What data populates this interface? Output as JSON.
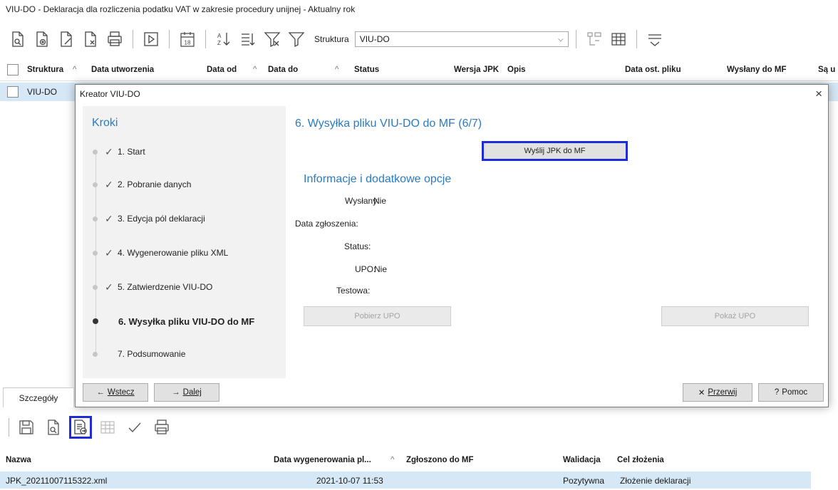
{
  "window": {
    "title": "VIU-DO - Deklaracja dla rozliczenia podatku VAT w zakresie procedury unijnej - Aktualny rok"
  },
  "toolbar": {
    "structure_label": "Struktura",
    "structure_value": "VIU-DO",
    "calendar_day": "18"
  },
  "grid": {
    "columns": [
      "Struktura",
      "Data utworzenia",
      "Data od",
      "Data do",
      "Status",
      "Wersja JPK",
      "Opis",
      "Data ost. pliku",
      "Wysłany do MF",
      "Są u"
    ],
    "rows": [
      {
        "struktura": "VIU-DO"
      }
    ]
  },
  "dialog": {
    "title": "Kreator VIU-DO",
    "close": "×",
    "steps_title": "Kroki",
    "steps": [
      {
        "label": "1. Start",
        "check": "✓"
      },
      {
        "label": "2. Pobranie danych",
        "check": "✓"
      },
      {
        "label": "3. Edycja pól deklaracji",
        "check": "✓"
      },
      {
        "label": "4. Wygenerowanie pliku XML",
        "check": "✓"
      },
      {
        "label": "5. Zatwierdzenie VIU-DO",
        "check": "✓"
      },
      {
        "label": "6. Wysyłka pliku VIU-DO do MF",
        "check": ""
      },
      {
        "label": "7. Podsumowanie",
        "check": ""
      }
    ],
    "content_title": "6. Wysyłka pliku VIU-DO do MF (6/7)",
    "send_button": "Wyślij JPK do MF",
    "info_title": "Informacje i dodatkowe opcje",
    "info": {
      "sent_label": "Wysłany:",
      "sent_value": "Nie",
      "date_label": "Data zgłoszenia:",
      "status_label": "Status:",
      "upo_label": "UPO:",
      "upo_value": "Nie",
      "test_label": "Testowa:"
    },
    "download_upo": "Pobierz UPO",
    "show_upo": "Pokaż UPO",
    "back": "Wstecz",
    "next": "Dalej",
    "cancel": "Przerwij",
    "help": "Pomoc"
  },
  "details": {
    "tab": "Szczegóły",
    "columns": [
      "Nazwa",
      "Data wygenerowania pl...",
      "Zgłoszono do MF",
      "Walidacja",
      "Cel złożenia"
    ],
    "rows": [
      {
        "name": "JPK_20211007115322.xml",
        "generated": "2021-10-07 11:53",
        "reported": "",
        "validation": "Pozytywna",
        "purpose": "Złożenie deklaracji"
      }
    ]
  }
}
